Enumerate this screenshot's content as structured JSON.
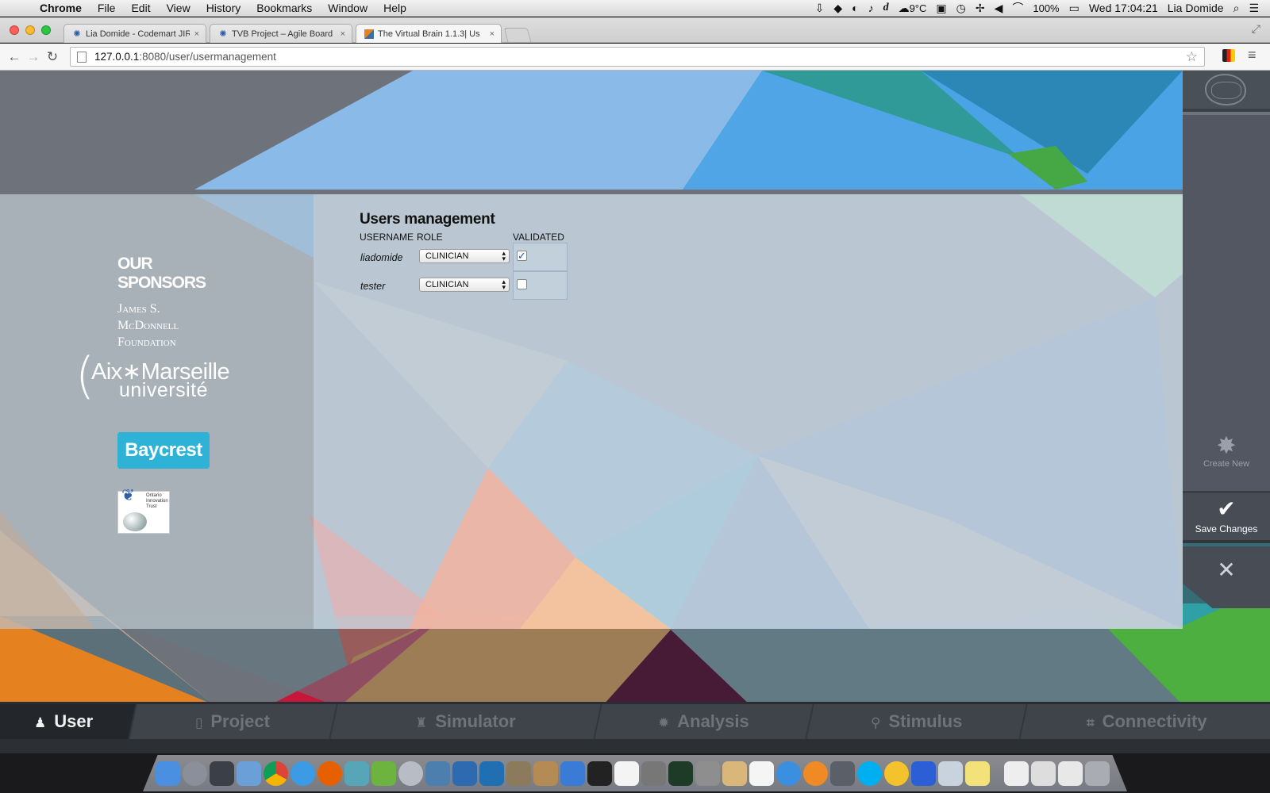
{
  "menubar": {
    "app": "Chrome",
    "items": [
      "File",
      "Edit",
      "View",
      "History",
      "Bookmarks",
      "Window",
      "Help"
    ],
    "weather": "9°C",
    "battery": "100%",
    "clock": "Wed 17:04:21",
    "user": "Lia Domide"
  },
  "tabs": [
    {
      "title": "Lia Domide - Codemart JIR",
      "close": "×"
    },
    {
      "title": "TVB Project – Agile Board",
      "close": "×"
    },
    {
      "title": "The Virtual Brain 1.1.3| Us",
      "close": "×"
    }
  ],
  "address": {
    "host": "127.0.0.1",
    "path": ":8080/user/usermanagement"
  },
  "sponsors": {
    "title": "OUR SPONSORS",
    "jsmf": [
      "James S.",
      "McDonnell",
      "Foundation"
    ],
    "amu_line1": "Aix∗Marseille",
    "amu_line2": "université",
    "baycrest": "Baycrest",
    "oit": "Ontario Innovation Trust"
  },
  "users_management": {
    "title": "Users management",
    "headers": {
      "username": "USERNAME",
      "role": "ROLE",
      "validated": "VALIDATED"
    },
    "rows": [
      {
        "username": "liadomide",
        "role": "CLINICIAN",
        "validated": true
      },
      {
        "username": "tester",
        "role": "CLINICIAN",
        "validated": false
      }
    ]
  },
  "sidebar": {
    "create_new": "Create New",
    "save_changes": "Save Changes",
    "close_icon": "close-icon"
  },
  "bottom_nav": [
    {
      "label": "User",
      "icon": "user-icon",
      "active": true
    },
    {
      "label": "Project",
      "icon": "project-icon",
      "active": false
    },
    {
      "label": "Simulator",
      "icon": "simulator-icon",
      "active": false
    },
    {
      "label": "Analysis",
      "icon": "analysis-icon",
      "active": false
    },
    {
      "label": "Stimulus",
      "icon": "stimulus-icon",
      "active": false
    },
    {
      "label": "Connectivity",
      "icon": "connectivity-icon",
      "active": false
    }
  ],
  "colors": {
    "orange": "#e5821f",
    "teal": "#2e9a9a",
    "sky_blue": "#8dbfe9",
    "bright_blue": "#4fa5e6",
    "green": "#4caf3f",
    "nav_bg": "#3f444b",
    "baycrest": "#2eb3d6"
  }
}
